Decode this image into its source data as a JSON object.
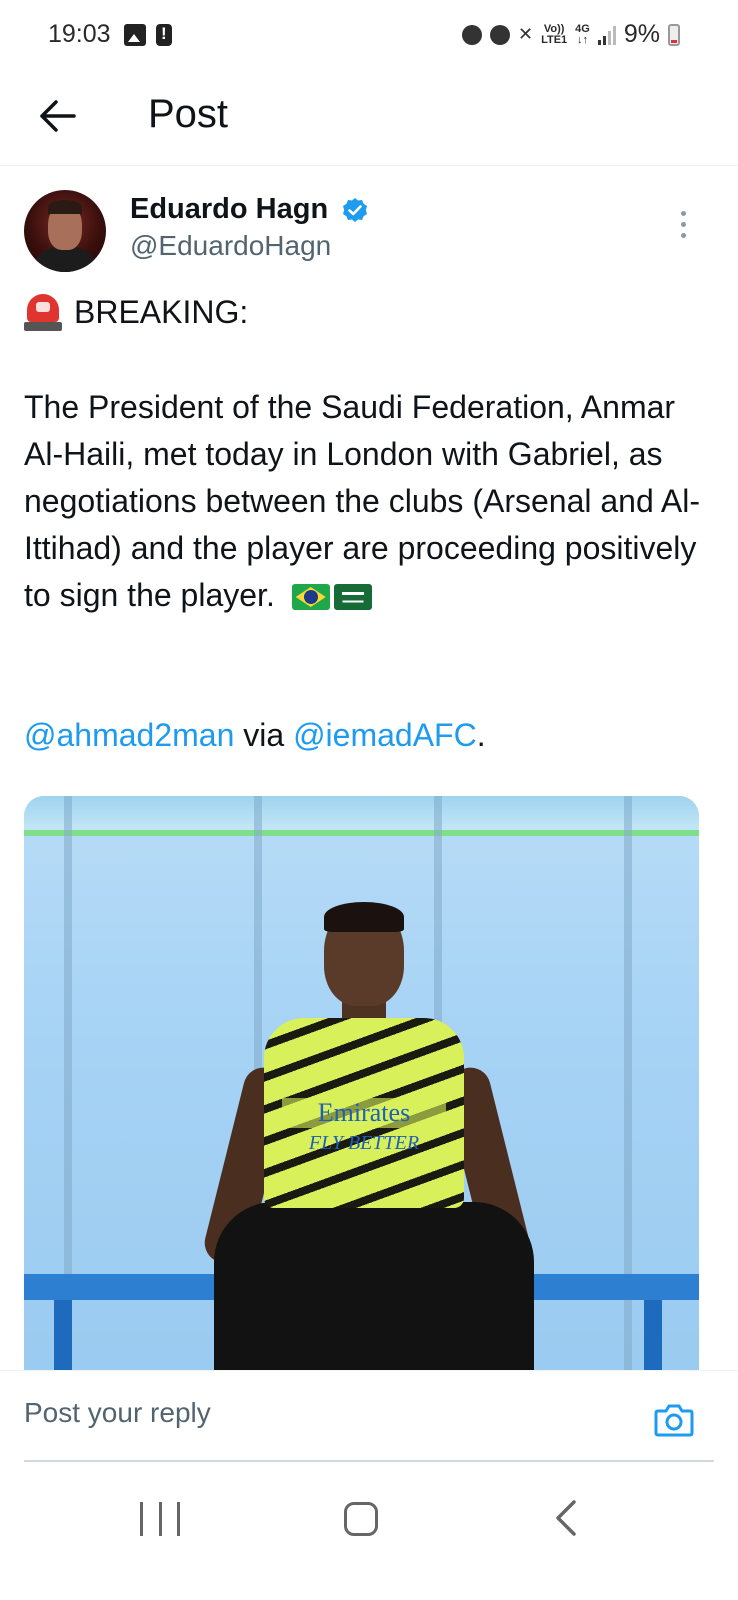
{
  "status_bar": {
    "time": "19:03",
    "network_top": "Vo))",
    "network_bottom": "LTE1",
    "network_type": "4G",
    "battery": "9%"
  },
  "header": {
    "title": "Post"
  },
  "tweet": {
    "author_name": "Eduardo Hagn",
    "author_handle": "@EduardoHagn",
    "breaking": "BREAKING:",
    "body": "The President of the Saudi Federation, Anmar Al-Haili, met today in London with Gabriel, as negotiations between the clubs (Arsenal and Al-Ittihad) and the player are proceeding positively to sign the player.",
    "mention_1": "@ahmad2man",
    "via": " via ",
    "mention_2": "@iemadAFC",
    "period": ".",
    "media": {
      "shirt_sponsor": "Emirates",
      "shirt_tagline": "FLY BETTER"
    }
  },
  "reply": {
    "placeholder": "Post your reply"
  },
  "colors": {
    "link": "#1d9bf0",
    "verified": "#1d9bf0",
    "secondary_text": "#536471"
  },
  "icons": {
    "back": "arrow-left-icon",
    "verified": "verified-badge-icon",
    "more": "more-vertical-icon",
    "camera": "camera-icon",
    "siren": "police-light-emoji",
    "flags": [
      "brazil-flag-emoji",
      "saudi-arabia-flag-emoji"
    ]
  }
}
